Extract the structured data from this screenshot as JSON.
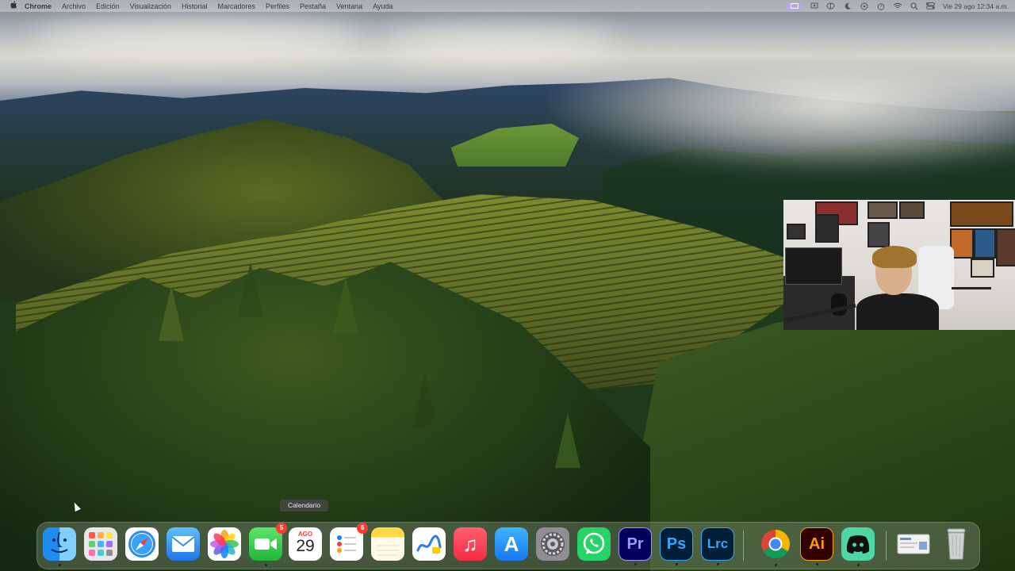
{
  "menubar": {
    "apple_icon": "apple-logo-icon",
    "app_name": "Chrome",
    "items": [
      "Archivo",
      "Edición",
      "Visualización",
      "Historial",
      "Marcadores",
      "Perfiles",
      "Pestaña",
      "Ventana",
      "Ayuda"
    ],
    "status_icons": [
      "screen-record-icon",
      "screen-mirror-icon",
      "brain-icon",
      "focus-moon-icon",
      "play-icon",
      "stopwatch-icon",
      "wifi-icon",
      "search-icon",
      "control-center-icon"
    ],
    "clock": "Vie 29 ago 12:34 a.m."
  },
  "dock": {
    "tooltip": "Calendario",
    "calendar": {
      "month": "AGO",
      "day": "29"
    },
    "apps": [
      {
        "name": "Finder",
        "icon": "finder-icon",
        "running": true
      },
      {
        "name": "Launchpad",
        "icon": "launchpad-icon",
        "running": false
      },
      {
        "name": "Safari",
        "icon": "safari-compass-icon",
        "running": false
      },
      {
        "name": "Mail",
        "icon": "mail-envelope-icon",
        "running": false
      },
      {
        "name": "Fotos",
        "icon": "photos-flower-icon",
        "running": false
      },
      {
        "name": "FaceTime",
        "icon": "facetime-camera-icon",
        "running": true,
        "badge": "5"
      },
      {
        "name": "Calendario",
        "icon": "calendar-icon",
        "running": false
      },
      {
        "name": "Recordatorios",
        "icon": "reminders-list-icon",
        "running": false,
        "badge": "6"
      },
      {
        "name": "Notas",
        "icon": "notes-icon",
        "running": false
      },
      {
        "name": "Freeform",
        "icon": "freeform-icon",
        "running": false
      },
      {
        "name": "Música",
        "icon": "music-note-icon",
        "running": false
      },
      {
        "name": "App Store",
        "icon": "app-store-icon",
        "running": false
      },
      {
        "name": "Ajustes del Sistema",
        "icon": "settings-gear-icon",
        "running": false
      },
      {
        "name": "WhatsApp",
        "icon": "whatsapp-icon",
        "running": false
      },
      {
        "name": "Premiere Pro",
        "icon": "premiere-icon",
        "label": "Pr",
        "running": true
      },
      {
        "name": "Photoshop",
        "icon": "photoshop-icon",
        "label": "Ps",
        "running": true
      },
      {
        "name": "Lightroom Classic",
        "icon": "lightroom-icon",
        "label": "Lrc",
        "running": true
      },
      {
        "name": "Google Chrome",
        "icon": "chrome-icon",
        "running": true
      },
      {
        "name": "Illustrator",
        "icon": "illustrator-icon",
        "label": "Ai",
        "running": true
      },
      {
        "name": "Discord",
        "icon": "discord-icon",
        "running": true
      },
      {
        "name": "Vista Previa",
        "icon": "preview-icon",
        "running": false
      },
      {
        "name": "Papelera",
        "icon": "trash-icon",
        "running": false
      }
    ],
    "symbols": {
      "music": "♫",
      "appstore": "A"
    }
  },
  "colors": {
    "badge": "#ff3b30",
    "premiere": "#9999ff",
    "photoshop": "#31a8ff",
    "illustrator": "#ff9a00",
    "whatsapp": "#25d366"
  }
}
